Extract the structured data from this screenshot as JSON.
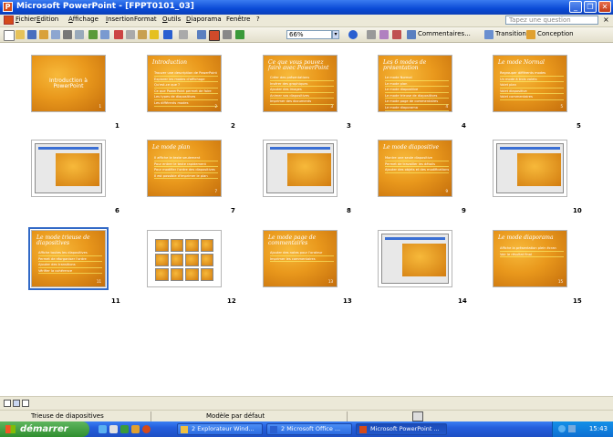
{
  "window": {
    "title": "Microsoft PowerPoint - [FPPT0101_03]"
  },
  "menu": {
    "items": [
      {
        "ul": "F",
        "rest": "ichier"
      },
      {
        "ul": "E",
        "rest": "dition"
      },
      {
        "ul": "A",
        "rest": "ffichage"
      },
      {
        "ul": "I",
        "rest": "nsertion"
      },
      {
        "ul": "",
        "rest": "Format"
      },
      {
        "ul": "O",
        "rest": "utils"
      },
      {
        "ul": "D",
        "rest": "iaporama"
      },
      {
        "ul": "",
        "rest": "Fenêtre"
      },
      {
        "ul": "",
        "rest": "?"
      }
    ],
    "ask_placeholder": "Tapez une question",
    "close_glyph": "× "
  },
  "toolbar": {
    "zoom": "66%",
    "commentaires": "Commentaires...",
    "transition": "Transition",
    "conception": "Conception"
  },
  "slides": [
    {
      "n": "1",
      "title": "Introduction à PowerPoint",
      "bullets": [],
      "kind": "title"
    },
    {
      "n": "2",
      "title": "Introduction",
      "bullets": [
        "Trouver une description de PowerPoint",
        "Explorer les modes d'affichage",
        "Qu'est-ce que ?",
        "Ce que PowerPoint permet de faire",
        "Les types de diapositives",
        "Les différents modes"
      ],
      "kind": "text"
    },
    {
      "n": "3",
      "title": "Ce que vous pouvez faire avec PowerPoint",
      "bullets": [
        "Créer des présentations",
        "Insérer des graphiques",
        "Ajouter des images",
        "Animer vos diapositives",
        "Imprimer des documents"
      ],
      "kind": "text"
    },
    {
      "n": "4",
      "title": "Les 6 modes de présentation",
      "bullets": [
        "Le mode Normal",
        "Le mode plan",
        "Le mode diapositive",
        "Le mode trieuse de diapositives",
        "Le mode page de commentaires",
        "Le mode diaporama"
      ],
      "kind": "text"
    },
    {
      "n": "5",
      "title": "Le mode Normal",
      "bullets": [
        "Regrouper différents modes",
        "Un mode à trois volets",
        "Volet plan",
        "Volet diapositive",
        "Volet commentaires"
      ],
      "kind": "text"
    },
    {
      "n": "6",
      "title": "",
      "bullets": [],
      "kind": "screen"
    },
    {
      "n": "7",
      "title": "Le mode plan",
      "bullets": [
        "Il affiche le texte seulement",
        "Pour entrer le texte rapidement",
        "Pour modifier l'ordre des diapositives",
        "Il est possible d'imprimer le plan"
      ],
      "kind": "text"
    },
    {
      "n": "8",
      "title": "",
      "bullets": [],
      "kind": "screen"
    },
    {
      "n": "9",
      "title": "Le mode diapositive",
      "bullets": [
        "Montre une seule diapositive",
        "Permet de travailler les détails",
        "Ajouter des objets et des modifications"
      ],
      "kind": "text"
    },
    {
      "n": "10",
      "title": "",
      "bullets": [],
      "kind": "screen"
    },
    {
      "n": "11",
      "title": "Le mode trieuse de diapositives",
      "bullets": [
        "Affiche toutes les diapositives",
        "Permet de réorganiser l'ordre",
        "Ajouter des transitions",
        "Vérifier la cohérence"
      ],
      "kind": "text",
      "selected": true
    },
    {
      "n": "12",
      "title": "",
      "bullets": [],
      "kind": "grid"
    },
    {
      "n": "13",
      "title": "Le mode page de commentaires",
      "bullets": [
        "Ajouter des notes pour l'orateur",
        "Imprimer les commentaires"
      ],
      "kind": "text"
    },
    {
      "n": "14",
      "title": "",
      "bullets": [],
      "kind": "screen"
    },
    {
      "n": "15",
      "title": "Le mode diaporama",
      "bullets": [
        "Affiche la présentation plein écran",
        "Voir le résultat final"
      ],
      "kind": "text"
    }
  ],
  "status": {
    "view": "Trieuse de diapositives",
    "template": "Modèle par défaut"
  },
  "taskbar": {
    "start": "démarrer",
    "tasks": [
      "2 Explorateur Wind...",
      "2 Microsoft Office ...",
      "Microsoft PowerPoint ..."
    ],
    "clock": "15:43"
  }
}
